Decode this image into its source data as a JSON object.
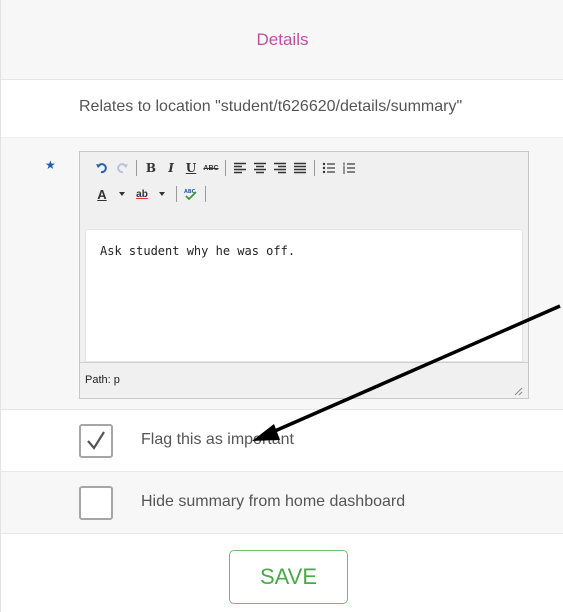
{
  "header": {
    "title": "Details"
  },
  "relates": {
    "text": "Relates to location \"student/t626620/details/summary\""
  },
  "editor": {
    "required_marker": "★",
    "toolbar": {
      "bold": "B",
      "italic": "I",
      "underline": "U",
      "strikethrough": "ABC",
      "font_color": "A",
      "highlight": "ab"
    },
    "content": "Ask student why he was off.",
    "path_label": "Path: p"
  },
  "options": [
    {
      "label": "Flag this as important",
      "checked": true
    },
    {
      "label": "Hide summary from home dashboard",
      "checked": false
    }
  ],
  "save": {
    "label": "SAVE"
  },
  "colors": {
    "title": "#c0509f",
    "save": "#4aaa4a",
    "required": "#1c5fb4"
  }
}
